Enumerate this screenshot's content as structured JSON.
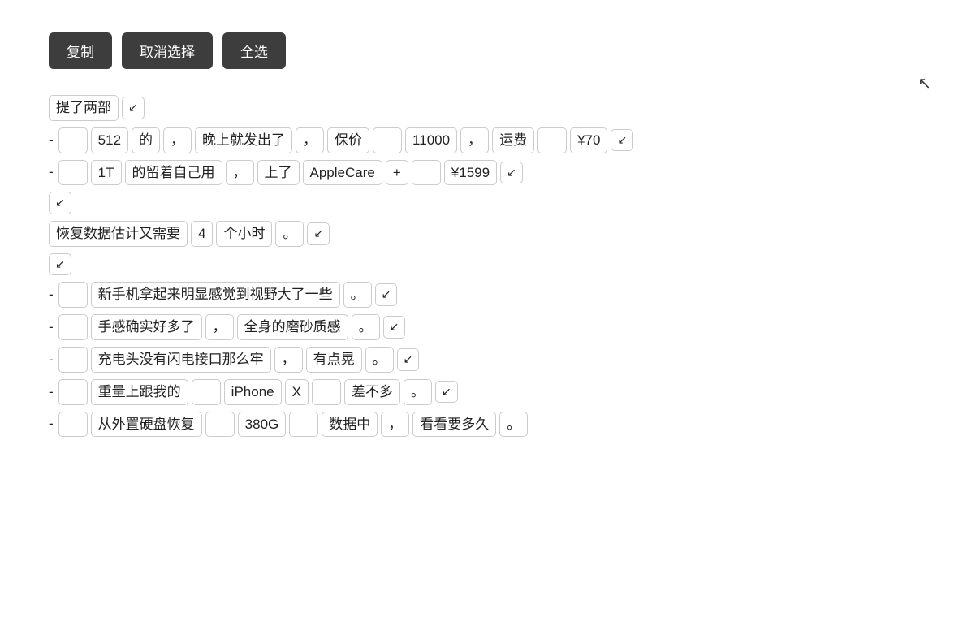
{
  "toolbar": {
    "copy_label": "复制",
    "deselect_label": "取消选择",
    "select_all_label": "全选"
  },
  "lines": [
    {
      "id": "line1",
      "type": "text-line",
      "tokens": [
        {
          "type": "token",
          "text": "提了两部"
        },
        {
          "type": "arrow"
        }
      ]
    },
    {
      "id": "line2",
      "type": "bullet-line",
      "tokens": [
        {
          "type": "bullet",
          "text": "-"
        },
        {
          "type": "token-empty"
        },
        {
          "type": "token",
          "text": "512"
        },
        {
          "type": "token",
          "text": "的"
        },
        {
          "type": "token",
          "text": "，"
        },
        {
          "type": "token",
          "text": "晚上就发出了"
        },
        {
          "type": "token",
          "text": "，"
        },
        {
          "type": "token",
          "text": "保价"
        },
        {
          "type": "token-empty"
        },
        {
          "type": "token",
          "text": "11000"
        },
        {
          "type": "token",
          "text": "，"
        },
        {
          "type": "token",
          "text": "运费"
        },
        {
          "type": "token-empty"
        },
        {
          "type": "token",
          "text": "¥70"
        },
        {
          "type": "arrow"
        }
      ]
    },
    {
      "id": "line3",
      "type": "bullet-line",
      "tokens": [
        {
          "type": "bullet",
          "text": "-"
        },
        {
          "type": "token-empty"
        },
        {
          "type": "token",
          "text": "1T"
        },
        {
          "type": "token",
          "text": "的留着自己用"
        },
        {
          "type": "token",
          "text": "，"
        },
        {
          "type": "token",
          "text": "上了"
        },
        {
          "type": "token",
          "text": "AppleCare"
        },
        {
          "type": "token",
          "text": "+"
        },
        {
          "type": "token-empty"
        },
        {
          "type": "token",
          "text": "¥1599"
        },
        {
          "type": "arrow"
        }
      ]
    },
    {
      "id": "line4",
      "type": "text-line",
      "tokens": [
        {
          "type": "arrow"
        }
      ]
    },
    {
      "id": "line5",
      "type": "text-line",
      "tokens": [
        {
          "type": "token",
          "text": "恢复数据估计又需要"
        },
        {
          "type": "token",
          "text": "4"
        },
        {
          "type": "token",
          "text": "个小时"
        },
        {
          "type": "token",
          "text": "。"
        },
        {
          "type": "arrow"
        }
      ]
    },
    {
      "id": "line6",
      "type": "text-line",
      "tokens": [
        {
          "type": "arrow"
        }
      ]
    },
    {
      "id": "line7",
      "type": "bullet-line",
      "tokens": [
        {
          "type": "bullet",
          "text": "-"
        },
        {
          "type": "token-empty"
        },
        {
          "type": "token",
          "text": "新手机拿起来明显感觉到视野大了一些"
        },
        {
          "type": "token",
          "text": "。"
        },
        {
          "type": "arrow"
        }
      ]
    },
    {
      "id": "line8",
      "type": "bullet-line",
      "tokens": [
        {
          "type": "bullet",
          "text": "-"
        },
        {
          "type": "token-empty"
        },
        {
          "type": "token",
          "text": "手感确实好多了"
        },
        {
          "type": "token",
          "text": "，"
        },
        {
          "type": "token",
          "text": "全身的磨砂质感"
        },
        {
          "type": "token",
          "text": "。"
        },
        {
          "type": "arrow"
        }
      ]
    },
    {
      "id": "line9",
      "type": "bullet-line",
      "tokens": [
        {
          "type": "bullet",
          "text": "-"
        },
        {
          "type": "token-empty"
        },
        {
          "type": "token",
          "text": "充电头没有闪电接口那么牢"
        },
        {
          "type": "token",
          "text": "，"
        },
        {
          "type": "token",
          "text": "有点晃"
        },
        {
          "type": "token",
          "text": "。"
        },
        {
          "type": "arrow"
        }
      ]
    },
    {
      "id": "line10",
      "type": "bullet-line",
      "tokens": [
        {
          "type": "bullet",
          "text": "-"
        },
        {
          "type": "token-empty"
        },
        {
          "type": "token",
          "text": "重量上跟我的"
        },
        {
          "type": "token-empty"
        },
        {
          "type": "token",
          "text": "iPhone"
        },
        {
          "type": "token",
          "text": "X"
        },
        {
          "type": "token-empty"
        },
        {
          "type": "token",
          "text": "差不多"
        },
        {
          "type": "token",
          "text": "。"
        },
        {
          "type": "arrow"
        }
      ]
    },
    {
      "id": "line11",
      "type": "bullet-line",
      "tokens": [
        {
          "type": "bullet",
          "text": "-"
        },
        {
          "type": "token-empty"
        },
        {
          "type": "token",
          "text": "从外置硬盘恢复"
        },
        {
          "type": "token-empty"
        },
        {
          "type": "token",
          "text": "380G"
        },
        {
          "type": "token-empty"
        },
        {
          "type": "token",
          "text": "数据中"
        },
        {
          "type": "token",
          "text": "，"
        },
        {
          "type": "token",
          "text": "看看要多久"
        },
        {
          "type": "token",
          "text": "。"
        }
      ]
    }
  ]
}
